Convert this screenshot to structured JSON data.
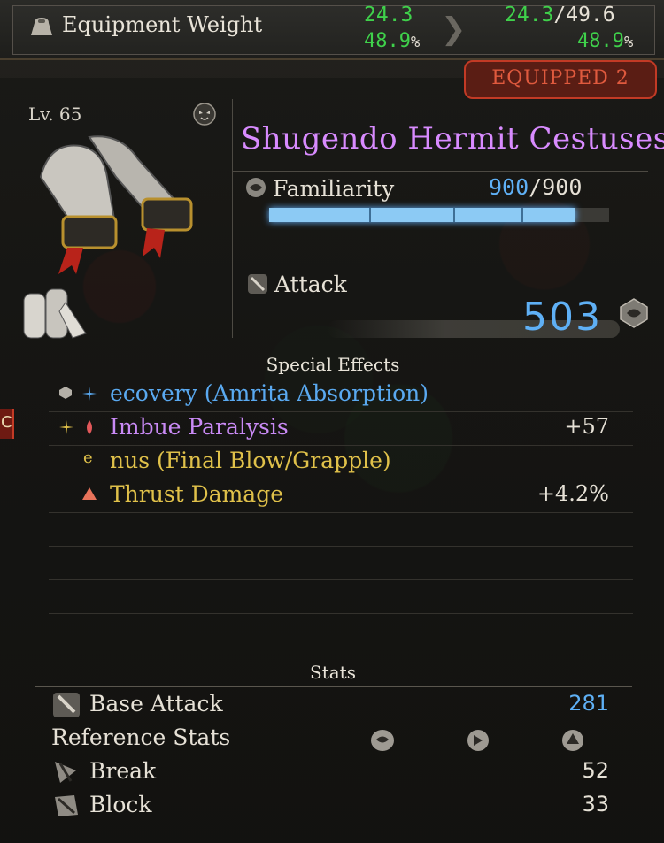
{
  "equipment_weight": {
    "label": "Equipment Weight",
    "current": "24.3",
    "current_pct": "48.9",
    "new": "24.3",
    "max": "49.6",
    "new_pct": "48.9",
    "pct_symbol": "%",
    "separator": "/",
    "arrow": "❯"
  },
  "badge": {
    "label": "EQUIPPED 2"
  },
  "item": {
    "level": "Lv. 65",
    "name": "Shugendo Hermit Cestuses",
    "familiarity": {
      "label": "Familiarity",
      "current": "900",
      "max": "900",
      "fill_fraction": 0.9,
      "separator": "/"
    },
    "attack": {
      "label": "Attack",
      "value": "503"
    }
  },
  "special_effects": {
    "title": "Special Effects",
    "items": [
      {
        "text": "ecovery (Amrita Absorption)",
        "value": "",
        "color": "#5aa9f0"
      },
      {
        "text": "Imbue Paralysis",
        "value": "+57",
        "color": "#c98af5"
      },
      {
        "text": "nus (Final Blow/Grapple)",
        "value": "",
        "color": "#e0c14a"
      },
      {
        "text": "Thrust Damage",
        "value": "+4.2%",
        "color": "#e0c14a"
      }
    ]
  },
  "stats": {
    "title": "Stats",
    "base_attack": {
      "label": "Base Attack",
      "value": "281"
    },
    "reference": {
      "label": "Reference Stats"
    },
    "break": {
      "label": "Break",
      "value": "52"
    },
    "block": {
      "label": "Block",
      "value": "33"
    }
  },
  "side_tab": {
    "label": "C"
  },
  "colors": {
    "green": "#3fd14b",
    "blue": "#5fb0f5",
    "purple": "#d88bff",
    "gold": "#e0c14a",
    "red_badge": "#c23a25"
  }
}
